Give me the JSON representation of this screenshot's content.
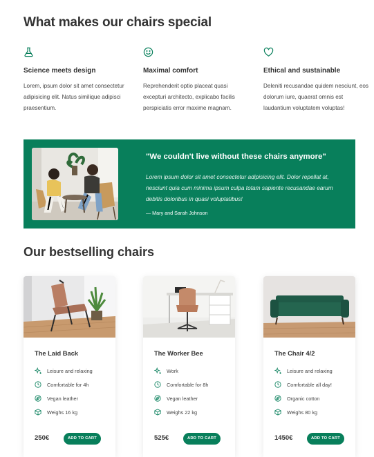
{
  "features": {
    "title": "What makes our chairs special",
    "items": [
      {
        "icon": "flask-icon",
        "title": "Science meets design",
        "text": "Lorem, ipsum dolor sit amet consectetur adipisicing elit. Natus similique adipisci praesentium."
      },
      {
        "icon": "smile-icon",
        "title": "Maximal comfort",
        "text": "Reprehenderit optio placeat quasi excepturi architecto, explicabo facilis perspiciatis error maxime magnam."
      },
      {
        "icon": "heart-icon",
        "title": "Ethical and sustainable",
        "text": "Deleniti recusandae quidem nesciunt, eos dolorum iure, quaerat omnis est laudantium voluptatem voluptas!"
      }
    ]
  },
  "testimonial": {
    "quote": "\"We couldn't live without these chairs anymore\"",
    "text": "Lorem ipsum dolor sit amet consectetur adipisicing elit. Dolor repellat at, nesciunt quia cum minima ipsum culpa totam sapiente recusandae earum debitis doloribus in quasi voluptatibus!",
    "author": "— Mary and Sarah Johnson"
  },
  "bestsellers": {
    "title": "Our bestselling chairs",
    "products": [
      {
        "name": "The Laid Back",
        "attributes": [
          {
            "icon": "sparkles-icon",
            "label": "Leisure and relaxing"
          },
          {
            "icon": "clock-icon",
            "label": "Comfortable for 4h"
          },
          {
            "icon": "leaf-icon",
            "label": "Vegan leather"
          },
          {
            "icon": "box-icon",
            "label": "Weighs 16 kg"
          }
        ],
        "price": "250€",
        "cta": "ADD TO CART"
      },
      {
        "name": "The Worker Bee",
        "attributes": [
          {
            "icon": "sparkles-icon",
            "label": "Work"
          },
          {
            "icon": "clock-icon",
            "label": "Comfortable for 8h"
          },
          {
            "icon": "leaf-icon",
            "label": "Vegan leather"
          },
          {
            "icon": "box-icon",
            "label": "Weighs 22 kg"
          }
        ],
        "price": "525€",
        "cta": "ADD TO CART"
      },
      {
        "name": "The Chair 4/2",
        "attributes": [
          {
            "icon": "sparkles-icon",
            "label": "Leisure and relaxing"
          },
          {
            "icon": "clock-icon",
            "label": "Comfortable all day!"
          },
          {
            "icon": "leaf-icon",
            "label": "Organic cotton"
          },
          {
            "icon": "box-icon",
            "label": "Weighs 80 kg"
          }
        ],
        "price": "1450€",
        "cta": "ADD TO CART"
      }
    ]
  },
  "colors": {
    "accent": "#087f5b",
    "text": "#333333"
  }
}
